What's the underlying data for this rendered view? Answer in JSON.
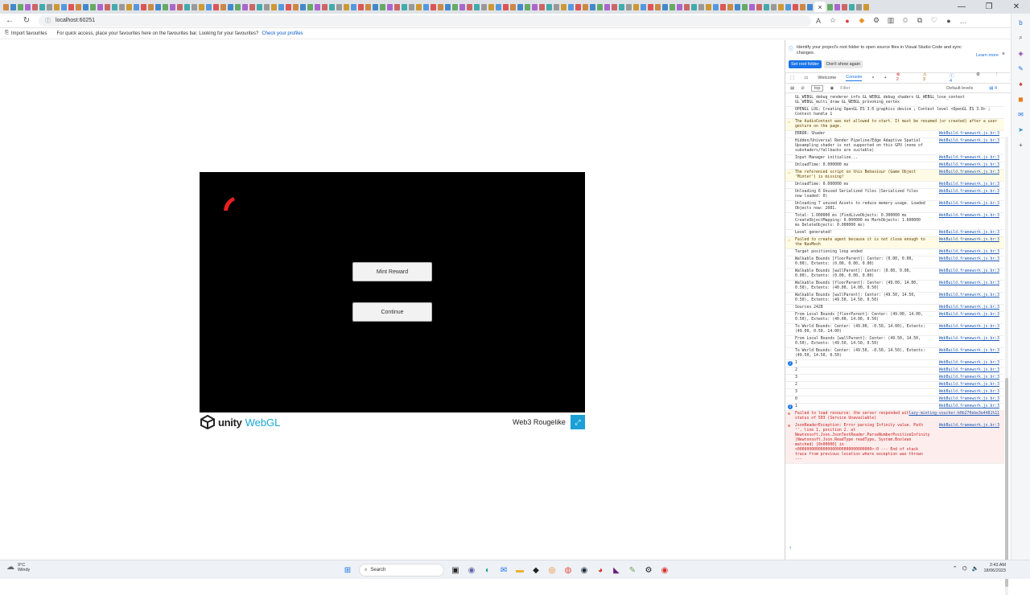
{
  "browser": {
    "active_tab_close": "×",
    "window_controls": [
      "—",
      "❐",
      "✕"
    ],
    "url": "localhost:60251",
    "favourites_bar": {
      "import_label": "Import favourites",
      "message": "For quick access, place your favourites here on the favourites bar. Looking for your favourites?",
      "link": "Check your profiles"
    }
  },
  "game": {
    "buttons": {
      "mint": "Mint Reward",
      "continue": "Continue"
    },
    "footer": {
      "unity": "unity",
      "webgl": "WebGL",
      "title": "Web3 Rougelike"
    }
  },
  "devtools": {
    "info": {
      "text": "Identify your project's root folder to open source files in Visual Studio Code and sync changes.",
      "learn_more": "Learn more",
      "set_root_button": "Set root folder",
      "dont_show_button": "Don't show again"
    },
    "tabs": [
      "Welcome",
      "Console"
    ],
    "active_tab": "Console",
    "counters": {
      "errors": "2",
      "warnings": "3",
      "info": "4",
      "issues": "4"
    },
    "filter": {
      "context": "top",
      "placeholder": "Filter",
      "levels": "Default levels"
    },
    "logs": [
      {
        "type": "log",
        "text": "GL_WEBGL_debug_renderer_info GL_WEBGL_debug_shaders GL_WEBGL_lose_context GL_WEBGL_multi_draw GL_WEBGL_provoking_vertex",
        "src": ""
      },
      {
        "type": "log",
        "text": "OPENGL LOG: Creating OpenGL ES 3.0 graphics device ; Context level  <OpenGL ES 3.0> ; Context handle 1",
        "src": ""
      },
      {
        "type": "warn",
        "text": "The AudioContext was not allowed to start. It must be resumed (or created) after a user gesture on the page.",
        "src": ""
      },
      {
        "type": "log",
        "text": "ERROR: Shader",
        "src": "WebBuild.framework.js.br:3"
      },
      {
        "type": "log",
        "text": "Hidden/Universal Render Pipeline/Edge Adaptive Spatial Upsampling shader is not supported on this GPU (none of subshaders/fallbacks are suitable)",
        "src": "WebBuild.framework.js.br:3"
      },
      {
        "type": "log",
        "text": "Input Manager initialize...",
        "src": "WebBuild.framework.js.br:3"
      },
      {
        "type": "log",
        "text": "UnloadTime: 0.000000 ms",
        "src": "WebBuild.framework.js.br:3"
      },
      {
        "type": "warn",
        "text": "The referenced script on this Behaviour (Game Object 'Minter') is missing!",
        "src": "WebBuild.framework.js.br:3"
      },
      {
        "type": "log",
        "text": "UnloadTime: 0.000000 ms",
        "src": "WebBuild.framework.js.br:3"
      },
      {
        "type": "log",
        "text": "Unloading 6 Unused Serialized files (Serialized files now loaded: 0)",
        "src": "WebBuild.framework.js.br:3"
      },
      {
        "type": "log",
        "text": "Unloading 7 unused Assets to reduce memory usage. Loaded Objects now: 2081.",
        "src": "WebBuild.framework.js.br:3"
      },
      {
        "type": "log",
        "text": "Total: 1.000000 ms (FindLiveObjects: 0.300000 ms CreateObjectMapping: 0.000000 ms MarkObjects: 1.600000 ms DeleteObjects: 0.000000 ms)",
        "src": "WebBuild.framework.js.br:3"
      },
      {
        "type": "log",
        "text": "Level generated!",
        "src": "WebBuild.framework.js.br:3"
      },
      {
        "type": "warn",
        "text": "Failed to create agent because it is not close enough to the NavMesh",
        "src": "WebBuild.framework.js.br:3"
      },
      {
        "type": "log",
        "text": "Target positioning loop ended",
        "src": "WebBuild.framework.js.br:3"
      },
      {
        "type": "log",
        "text": "Walkable Bounds [floorParent]: Center: (0.00, 0.00, 0.00), Extents: (0.00, 0.00, 0.00)",
        "src": "WebBuild.framework.js.br:3"
      },
      {
        "type": "log",
        "text": "Walkable Bounds [wallParent]: Center: (0.00, 0.00, 0.00), Extents: (0.00, 0.00, 0.00)",
        "src": "WebBuild.framework.js.br:3"
      },
      {
        "type": "log",
        "text": "Walkable Bounds [floorParent]: Center: (49.00, 14.00, 0.50), Extents: (40.00, 14.00, 0.50)",
        "src": "WebBuild.framework.js.br:3"
      },
      {
        "type": "log",
        "text": "Walkable Bounds [wallParent]: Center: (49.50, 14.50, 0.50), Extents: (49.50, 14.50, 0.50)",
        "src": "WebBuild.framework.js.br:3"
      },
      {
        "type": "log",
        "text": "Sources 2428",
        "src": "WebBuild.framework.js.br:3"
      },
      {
        "type": "log",
        "text": "From Local Bounds [floorParent]: Center: (49.00, 14.00, 0.50), Extents: (40.00, 14.00, 0.50)",
        "src": "WebBuild.framework.js.br:3"
      },
      {
        "type": "log",
        "text": "To World Bounds: Center: (49.00, -0.50, 14.00), Extents: (49.00, 0.50, 14.00)",
        "src": "WebBuild.framework.js.br:3"
      },
      {
        "type": "log",
        "text": "From Local Bounds [wallParent]: Center: (49.50, 14.50, 0.50), Extents: (49.50, 14.50, 0.50)",
        "src": "WebBuild.framework.js.br:3"
      },
      {
        "type": "log",
        "text": "To World Bounds: Center: (49.50, -0.50, 14.50), Extents: (49.50, 14.50, 0.50)",
        "src": "WebBuild.framework.js.br:3"
      },
      {
        "type": "count",
        "text": "1",
        "src": "WebBuild.framework.js.br:3",
        "n": "2"
      },
      {
        "type": "log",
        "text": "2",
        "src": "WebBuild.framework.js.br:3"
      },
      {
        "type": "log",
        "text": "3",
        "src": "WebBuild.framework.js.br:3"
      },
      {
        "type": "log",
        "text": "2",
        "src": "WebBuild.framework.js.br:3"
      },
      {
        "type": "log",
        "text": "3",
        "src": "WebBuild.framework.js.br:3"
      },
      {
        "type": "log",
        "text": "0",
        "src": "WebBuild.framework.js.br:3"
      },
      {
        "type": "count",
        "text": "1",
        "src": "WebBuild.framework.js.br:3",
        "n": "2"
      },
      {
        "type": "err",
        "text": "Failed to load resource: the server responded with a status of 503 (Service Unavailable)",
        "src": "lazy-minting-voucher-b0b270ebe3e4481%11"
      },
      {
        "type": "err",
        "text": "JsonReaderException: Error parsing Infinity value. Path '', line 1, position 2.   at Newtonsoft.Json.JsonTextReader.ParseNumberPositiveInfinity (Newtonsoft.Json.ReadType readType, System.Boolean matched) [0x00000] in <00000000000000000000000000000000>:0   --- End of stack trace from previous location where exception was thrown ---",
        "src": "WebBuild.framework.js.br:3"
      }
    ],
    "prompt": "›"
  },
  "taskbar": {
    "weather_temp": "9°C",
    "weather_desc": "Windy",
    "search": "Search",
    "time": "2:43 AM",
    "date": "18/06/2023"
  }
}
